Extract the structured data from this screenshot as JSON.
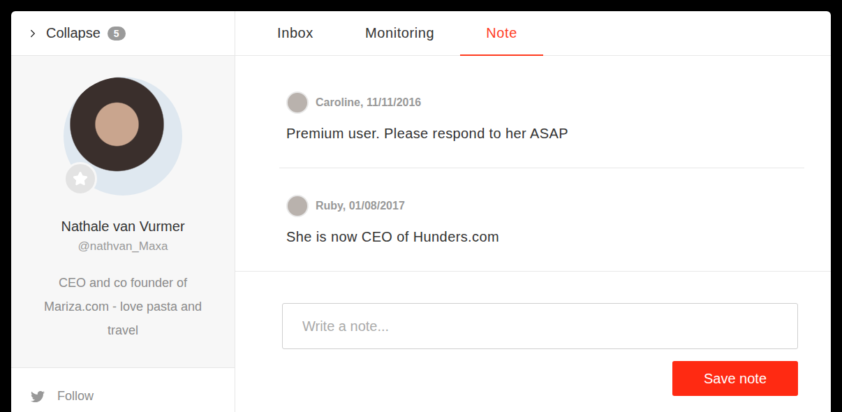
{
  "sidebar": {
    "collapse": {
      "label": "Collapse",
      "count": "5"
    },
    "profile": {
      "name": "Nathale van Vurmer",
      "handle": "@nathvan_Maxa",
      "bio": "CEO and co founder of Mariza.com - love pasta and travel",
      "starred": false
    },
    "follow": {
      "label": "Follow"
    }
  },
  "tabs": [
    {
      "label": "Inbox",
      "selected": false
    },
    {
      "label": "Monitoring",
      "selected": false
    },
    {
      "label": "Note",
      "selected": true
    }
  ],
  "notes": [
    {
      "byline": "Caroline, 11/11/2016",
      "text": "Premium user. Please respond to her ASAP"
    },
    {
      "byline": "Ruby, 01/08/2017",
      "text": "She is now CEO of Hunders.com"
    }
  ],
  "composer": {
    "placeholder": "Write a note...",
    "button": "Save note"
  }
}
